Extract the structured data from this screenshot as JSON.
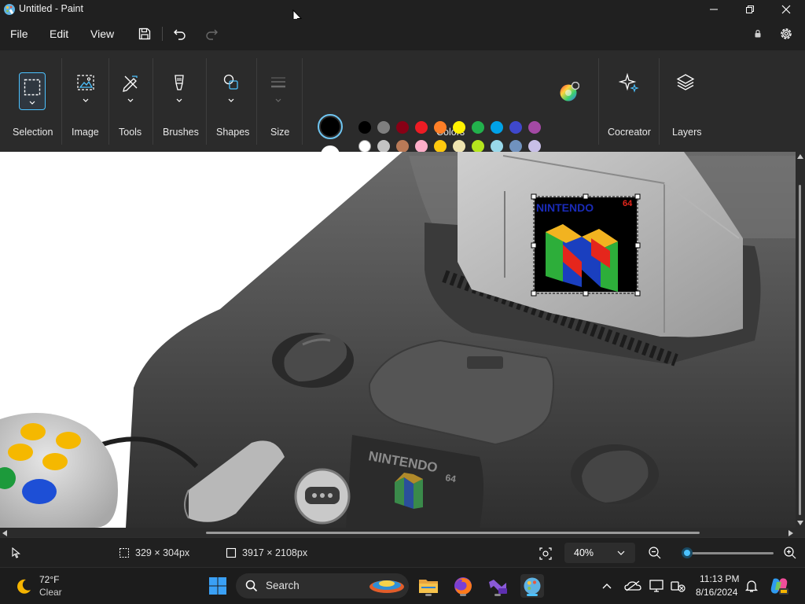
{
  "window": {
    "title": "Untitled - Paint",
    "icon": "paint-app-icon",
    "controls": [
      "minimize-icon",
      "restore-icon",
      "close-icon"
    ]
  },
  "menu": {
    "items": [
      "File",
      "Edit",
      "View"
    ],
    "quick_access": [
      "save-icon",
      "undo-icon",
      "redo-icon"
    ],
    "right_icons": [
      "account-icon",
      "settings-gear-icon"
    ]
  },
  "ribbon": {
    "groups": [
      {
        "label": "Selection",
        "icon": "rectangle-select-icon"
      },
      {
        "label": "Image",
        "icon": "image-crop-icon"
      },
      {
        "label": "Tools",
        "icon": "pencil-tools-icon"
      },
      {
        "label": "Brushes",
        "icon": "brush-icon"
      },
      {
        "label": "Shapes",
        "icon": "shapes-icon"
      },
      {
        "label": "Size",
        "icon": "line-size-icon"
      }
    ],
    "colors": {
      "label": "Colors",
      "primary": "#000000",
      "secondary": "#ffffff",
      "row1": [
        "#000000",
        "#7f7f7f",
        "#880015",
        "#ed1c24",
        "#ff7f27",
        "#fff200",
        "#22b14c",
        "#00a2e8",
        "#3f48cc",
        "#a349a4"
      ],
      "row2": [
        "#ffffff",
        "#c3c3c3",
        "#b97a57",
        "#ffaec9",
        "#ffc90e",
        "#efe4b0",
        "#b5e61d",
        "#99d9ea",
        "#7092be",
        "#c8bfe7"
      ],
      "custom_slots": 10,
      "edit_colors_icon": "color-wheel-icon"
    },
    "cocreator": {
      "label": "Cocreator",
      "icon": "sparkle-icon"
    },
    "layers": {
      "label": "Layers",
      "icon": "layers-icon"
    }
  },
  "canvas_artwork_text": {
    "logo_word": "NINTENDO",
    "logo_number": "64",
    "console_badge": "NINTENDO",
    "console_badge_number": "64"
  },
  "status": {
    "pointer_icon": "pointer-icon",
    "selection_size": "329 × 304px",
    "canvas_size": "3917 × 2108px",
    "zoom": "40%",
    "zoom_icons": [
      "fit-to-window-icon",
      "chevron-down-icon",
      "zoom-out-icon",
      "zoom-in-icon"
    ],
    "zoom_slider_level": 0.05
  },
  "taskbar": {
    "weather_temp": "72°F",
    "weather_desc": "Clear",
    "search_placeholder": "Search",
    "time": "11:13 PM",
    "date": "8/16/2024",
    "apps": [
      "windows-start-icon",
      "file-explorer-icon",
      "firefox-icon",
      "visual-studio-icon",
      "paint-app-icon"
    ],
    "tray": [
      "chevron-up-icon",
      "onedrive-icon",
      "display-icon",
      "network-icon",
      "notification-bell-icon",
      "copilot-icon"
    ]
  }
}
